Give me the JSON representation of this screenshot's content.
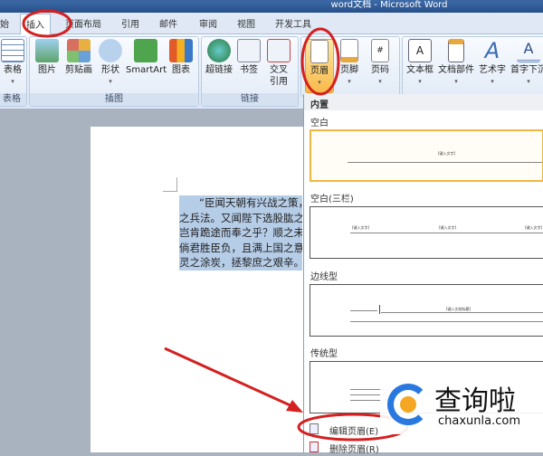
{
  "title": "word文档 - Microsoft Word",
  "tabs": [
    "始",
    "插入",
    "页面布局",
    "引用",
    "邮件",
    "审阅",
    "视图",
    "开发工具"
  ],
  "groups": {
    "table": "表格",
    "illustrations": "插图",
    "links": "链接"
  },
  "buttons": {
    "table": "表格",
    "picture": "图片",
    "clipart": "剪贴画",
    "shapes": "形状",
    "smartart": "SmartArt",
    "chart": "图表",
    "hyperlink": "超链接",
    "bookmark": "书签",
    "crossref1": "交叉",
    "crossref2": "引用",
    "header": "页眉",
    "footer": "页脚",
    "pagenum": "页码",
    "textbox": "文本框",
    "quickparts": "文档部件",
    "wordart": "艺术字",
    "dropcap": "首字下沉"
  },
  "document_lines": [
    "“臣闻天朝有兴战之策，",
    "之兵法。又闻陛下选股肱之",
    "岂肯跪途而奉之乎？顺之未",
    "倘君胜臣负，且满上国之意",
    "灵之涂炭，拯黎庶之艰辛。"
  ],
  "menu": {
    "section": "内置",
    "items": [
      {
        "label": "空白",
        "placeholder": "[键入文字]"
      },
      {
        "label": "空白(三栏)",
        "placeholder": "[键入文字]"
      },
      {
        "label": "边线型",
        "placeholder": "[键入文档标题]"
      },
      {
        "label": "传统型"
      }
    ],
    "edit": "编辑页眉(E)",
    "remove": "删除页眉(R)"
  },
  "watermark": {
    "brand": "查询啦",
    "url": "chaxunla.com"
  },
  "colors": {
    "annotation": "#d42020",
    "selected": "#f3b640"
  }
}
